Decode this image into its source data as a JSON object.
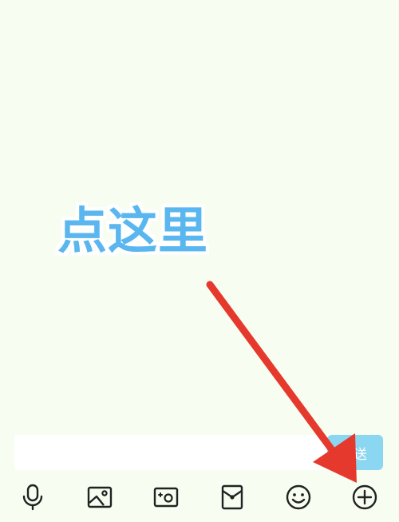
{
  "annotation": {
    "label": "点这里",
    "color": "#5ab6ef",
    "arrow_color": "#e6392d"
  },
  "chat_input": {
    "value": "",
    "placeholder": ""
  },
  "send": {
    "label": "送",
    "color": "#8bd6f1"
  },
  "toolbar": {
    "items": [
      {
        "icon": "microphone-icon"
      },
      {
        "icon": "image-icon"
      },
      {
        "icon": "camera-icon"
      },
      {
        "icon": "red-envelope-icon"
      },
      {
        "icon": "emoji-icon"
      },
      {
        "icon": "plus-icon"
      }
    ]
  },
  "colors": {
    "background": "#f7fef1",
    "icon_stroke": "#222222"
  }
}
